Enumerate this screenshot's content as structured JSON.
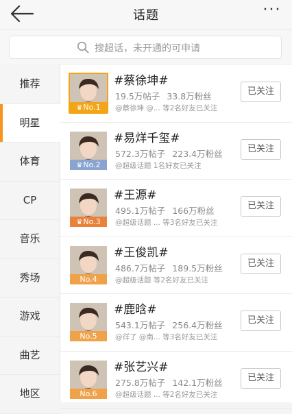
{
  "header": {
    "title": "话题",
    "back_icon": "arrow-left-icon",
    "more_icon": "more-dots-icon",
    "more_glyph": "···"
  },
  "search": {
    "placeholder": "搜超话，未开通的可申请",
    "icon": "search-icon"
  },
  "sidebar": {
    "active_index": 1,
    "accent_color": "#f7931e",
    "items": [
      {
        "label": "推荐"
      },
      {
        "label": "明星"
      },
      {
        "label": "体育"
      },
      {
        "label": "CP"
      },
      {
        "label": "音乐"
      },
      {
        "label": "秀场"
      },
      {
        "label": "游戏"
      },
      {
        "label": "曲艺"
      },
      {
        "label": "地区"
      }
    ]
  },
  "topics": [
    {
      "name": "#蔡徐坤#",
      "posts": "19.5万帖子",
      "fans": "33.8万粉丝",
      "friends": "@蔡徐坤 @... 等2名好友已关注",
      "rank": "No.1",
      "rank_color": "#f2a516",
      "follow": "已关注"
    },
    {
      "name": "#易烊千玺#",
      "posts": "572.3万帖子",
      "fans": "223.4万粉丝",
      "friends": "@超级话题 1名好友已关注",
      "rank": "No.2",
      "rank_color": "#8aa3cf",
      "follow": "已关注"
    },
    {
      "name": "#王源#",
      "posts": "495.1万帖子",
      "fans": "166万粉丝",
      "friends": "@超级话题 ... 等3名好友已关注",
      "rank": "No.3",
      "rank_color": "#e9823a",
      "follow": "已关注"
    },
    {
      "name": "#王俊凯#",
      "posts": "486.7万帖子",
      "fans": "189.5万粉丝",
      "friends": "@超级话题 等2名好友已关注",
      "rank": "No.4",
      "rank_color": "#f0a24a",
      "follow": "已关注"
    },
    {
      "name": "#鹿晗#",
      "posts": "543.1万帖子",
      "fans": "256.4万粉丝",
      "friends": "@徉了 @南... 等3名好友已关注",
      "rank": "No.5",
      "rank_color": "#f0a24a",
      "follow": "已关注"
    },
    {
      "name": "#张艺兴#",
      "posts": "275.8万帖子",
      "fans": "142.1万粉丝",
      "friends": "@超级话题 ... 等2名好友已关注",
      "rank": "No.6",
      "rank_color": "#f0a24a",
      "follow": "已关注"
    }
  ]
}
